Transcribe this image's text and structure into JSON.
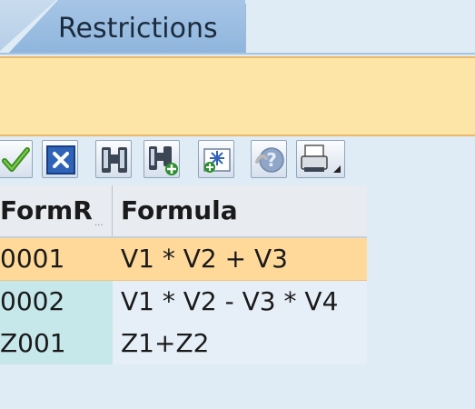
{
  "tabs": [
    {
      "label": "Restrictions"
    }
  ],
  "toolbar": {
    "buttons": [
      {
        "name": "check-icon"
      },
      {
        "name": "cancel-icon"
      },
      {
        "name": "find-icon"
      },
      {
        "name": "find-next-icon"
      },
      {
        "name": "insert-icon"
      },
      {
        "name": "help-icon"
      },
      {
        "name": "print-icon"
      }
    ]
  },
  "table": {
    "columns": [
      "FormR",
      "Formula"
    ],
    "rows": [
      {
        "key": "0001",
        "formula": "V1 * V2 + V3",
        "selected": true
      },
      {
        "key": "0002",
        "formula": "V1 * V2 - V3 * V4",
        "selected": false
      },
      {
        "key": "Z001",
        "formula": "Z1+Z2",
        "selected": false
      }
    ]
  },
  "colors": {
    "selected_row": "#ffd99a",
    "key_column": "#c6e8ea",
    "message_bar": "#fde5a8",
    "tab": "#9fbfe2"
  }
}
